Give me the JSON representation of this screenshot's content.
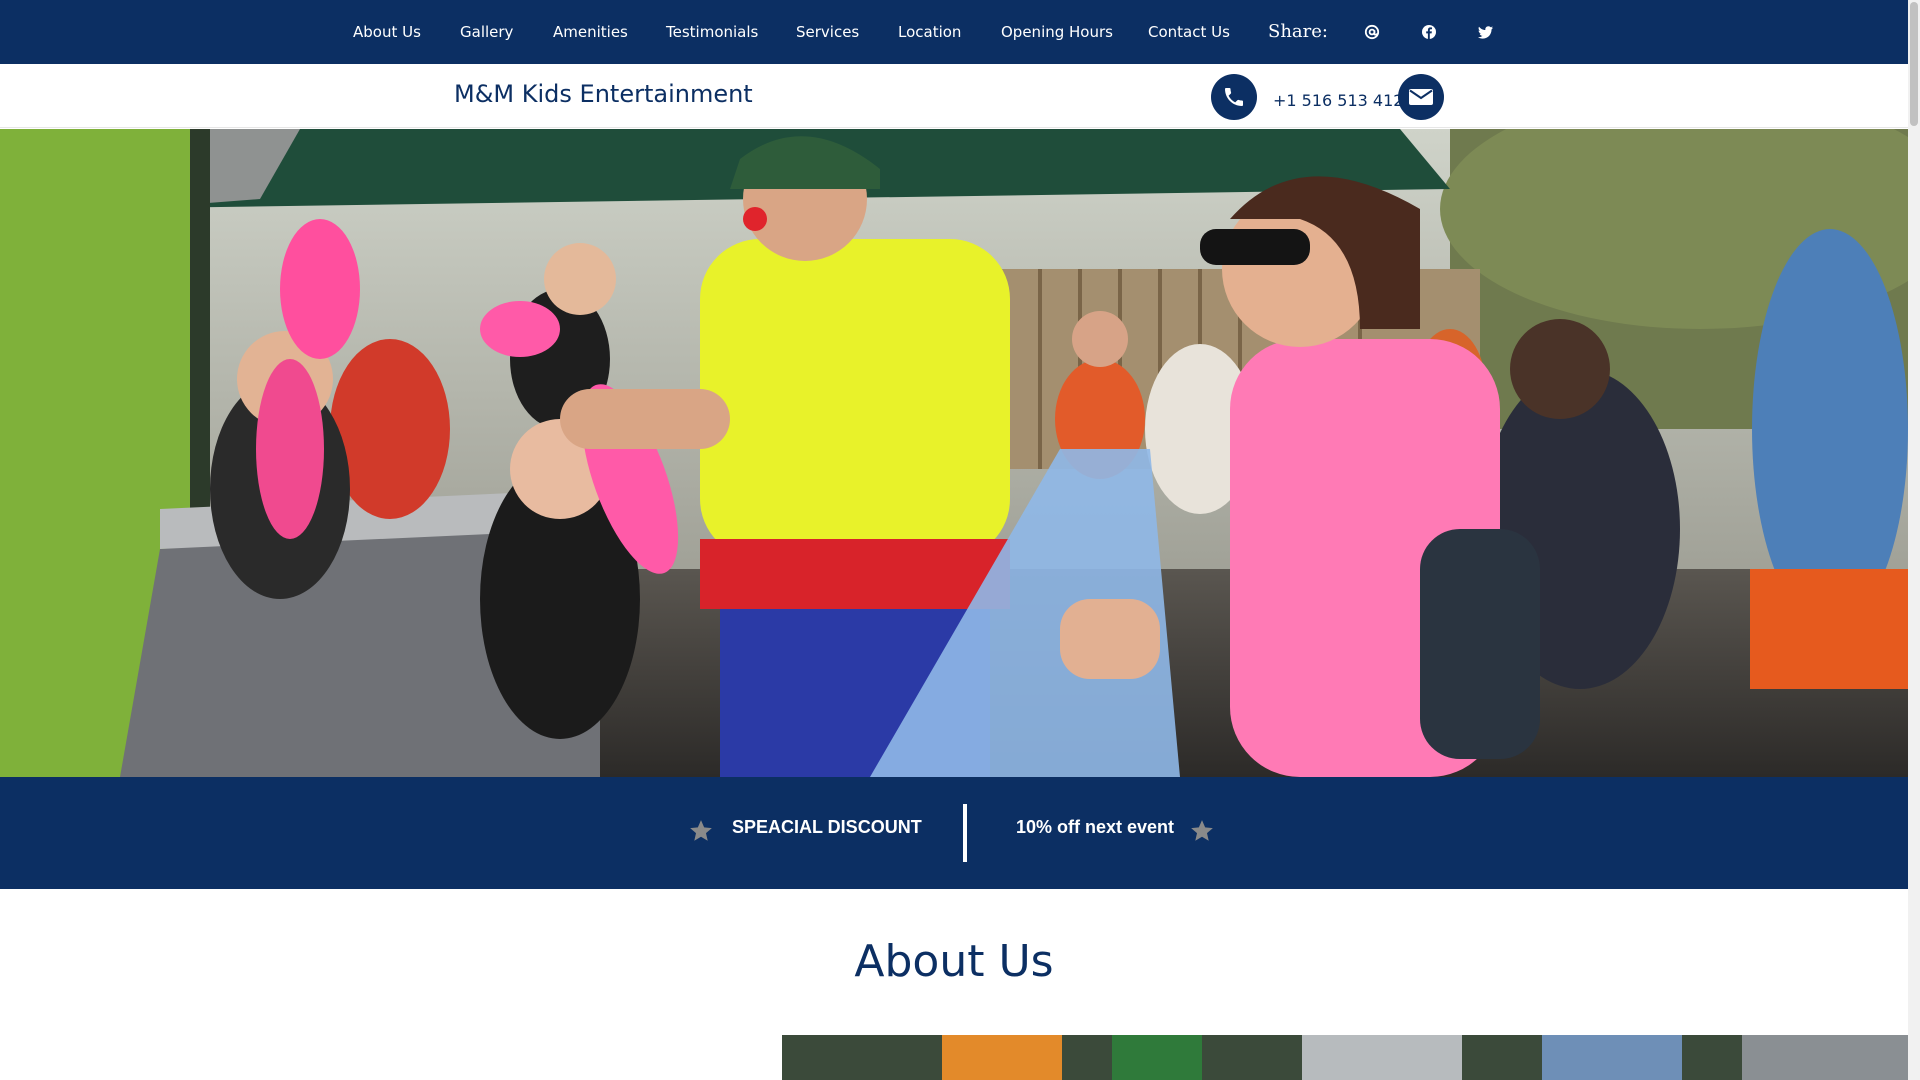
{
  "nav": {
    "items": [
      {
        "label": "About Us"
      },
      {
        "label": "Gallery"
      },
      {
        "label": "Amenities"
      },
      {
        "label": "Testimonials"
      },
      {
        "label": "Services"
      },
      {
        "label": "Location"
      },
      {
        "label": "Opening Hours"
      },
      {
        "label": "Contact Us"
      }
    ],
    "share_label": "Share:",
    "share_icons": [
      "at-icon",
      "facebook-icon",
      "twitter-icon"
    ]
  },
  "header": {
    "brand": "M&M Kids Entertainment",
    "phone": "+1 516 513 4123",
    "icons": [
      "phone-icon",
      "envelope-icon"
    ]
  },
  "discount": {
    "left_text": "SPEACIAL DISCOUNT",
    "right_text": "10% off next event",
    "icon": "star-icon"
  },
  "about": {
    "title": "About Us"
  },
  "colors": {
    "brand_navy": "#0c2f63",
    "white": "#ffffff",
    "star_gray": "#8a8a8a"
  }
}
